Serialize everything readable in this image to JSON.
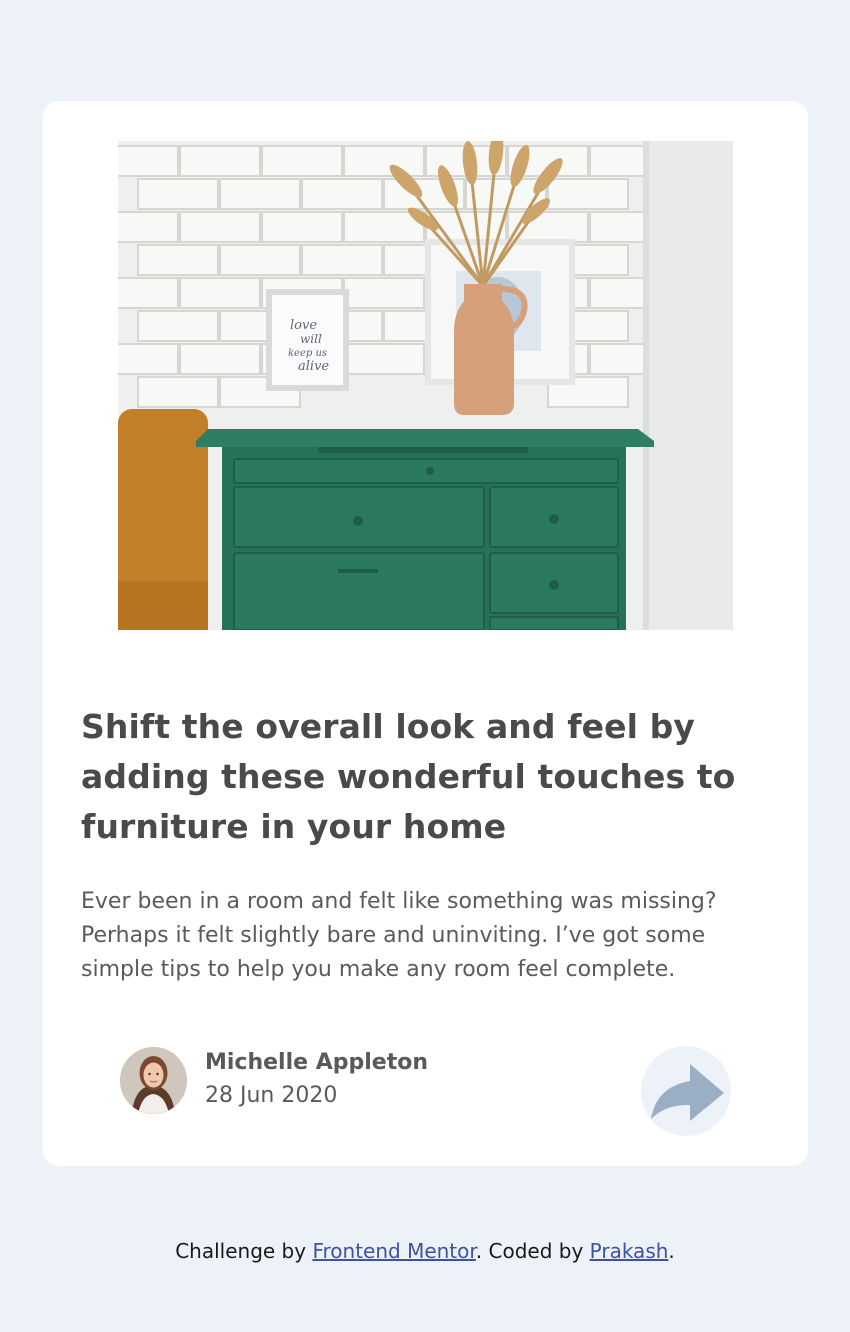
{
  "article": {
    "image": {
      "subject": "green-dresser-photo"
    },
    "title": "Shift the overall look and feel by adding these wonderful touches to furniture in your home",
    "description": "Ever been in a room and felt like something was missing? Perhaps it felt slightly bare and uninviting. I’ve got some simple tips to help you make any room feel complete.",
    "author": {
      "name": "Michelle Appleton",
      "date": "28 Jun 2020"
    },
    "share_icon": "share-arrow-icon"
  },
  "footer": {
    "prefix": "Challenge by ",
    "link1": "Frontend Mentor",
    "middle": ". Coded by ",
    "link2": "Prakash",
    "suffix": "."
  },
  "colors": {
    "page_background": "#ecf2f8",
    "card_background": "#ffffff",
    "heading": "#4a4a4a",
    "share_icon": "#9aaec4",
    "link": "#3e52a3"
  }
}
